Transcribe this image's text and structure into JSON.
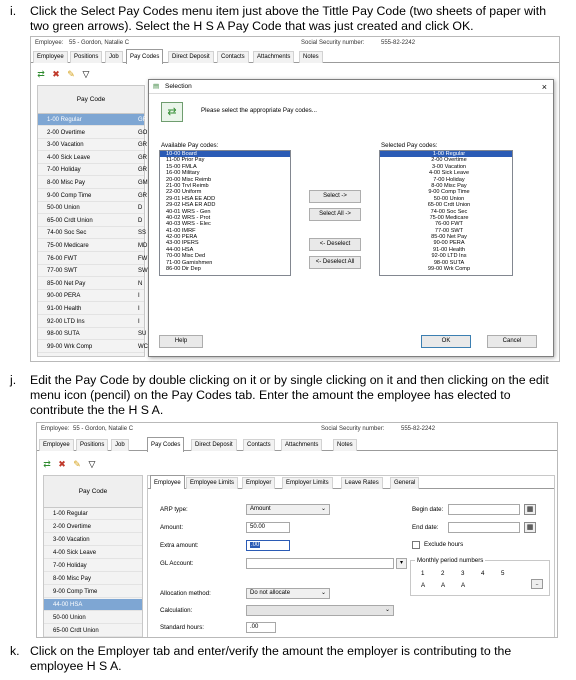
{
  "step_i": {
    "num": "i.",
    "text": "Click the Select Pay Codes menu item just above the Tittle Pay Code (two sheets of paper with two green arrows).  Select the H S A Pay Code that was just created and click OK."
  },
  "step_j": {
    "num": "j.",
    "text": "Edit the Pay Code by double clicking on it or by single clicking on it and then clicking on the edit menu icon (pencil) on the Pay Codes tab.  Enter the amount the employee has elected to contribute the the H S A."
  },
  "step_k": {
    "num": "k.",
    "text": "Click on the Employer tab and enter/verify the amount the employer is contributing to the employee H S A."
  },
  "shot1": {
    "employee_label": "Employee:",
    "employee_value": "55 - Gordon, Natalie C",
    "ssn_label": "Social Security number:",
    "ssn_value": "555-82-2242",
    "tabs": [
      "Employee",
      "Positions",
      "Job",
      "Pay Codes",
      "Direct Deposit",
      "Contacts",
      "Attachments",
      "Notes"
    ],
    "column_header": "Pay Code",
    "codes": [
      {
        "label": "1-00  Regular",
        "type": "GR"
      },
      {
        "label": "2-00  Overtime",
        "type": "GO"
      },
      {
        "label": "3-00  Vacation",
        "type": "GR"
      },
      {
        "label": "4-00  Sick Leave",
        "type": "GR"
      },
      {
        "label": "7-00  Holiday",
        "type": "GR"
      },
      {
        "label": "8-00  Misc Pay",
        "type": "GM"
      },
      {
        "label": "9-00  Comp Time",
        "type": "GR"
      },
      {
        "label": "50-00  Union",
        "type": "D"
      },
      {
        "label": "65-00  Crdt Union",
        "type": "D"
      },
      {
        "label": "74-00  Soc Sec",
        "type": "SS"
      },
      {
        "label": "75-00  Medicare",
        "type": "MD"
      },
      {
        "label": "76-00  FWT",
        "type": "FW"
      },
      {
        "label": "77-00  SWT",
        "type": "SW"
      },
      {
        "label": "85-00  Net Pay",
        "type": "N"
      },
      {
        "label": "90-00  PERA",
        "type": "I"
      },
      {
        "label": "91-00  Health",
        "type": "I"
      },
      {
        "label": "92-00  LTD Ins",
        "type": "I"
      },
      {
        "label": "98-00  SUTA",
        "type": "SU"
      },
      {
        "label": "99-00  Wrk Comp",
        "type": "WC"
      }
    ],
    "dialog": {
      "title": "Selection",
      "close": "×",
      "prompt": "Please select the appropriate Pay codes...",
      "available_label": "Available Pay codes:",
      "selected_label": "Selected Pay codes:",
      "available": [
        "10-00  Board",
        "11-00  Prior Pay",
        "15-00  FMLA",
        "16-00  Military",
        "20-00  Misc Reimb",
        "21-00  Trvl Reimb",
        "22-00  Uniform",
        "29-01  HSA EE ADD",
        "29-02  HSA ER ADD",
        "40-01  WRS - Gen",
        "40-02  WRS - Prot",
        "40-03  WRS - Elec",
        "41-00  IMRF",
        "42-00  PERA",
        "43-00  IPERS",
        "44-00  HSA",
        "70-00  Misc Ded",
        "71-00  Garnishmen",
        "86-00  Dir Dep"
      ],
      "selected": [
        "1-00  Regular",
        "2-00  Overtime",
        "3-00  Vacation",
        "4-00  Sick Leave",
        "7-00  Holiday",
        "8-00  Misc Pay",
        "9-00  Comp Time",
        "50-00  Union",
        "65-00  Crdt Union",
        "74-00  Soc Sec",
        "75-00  Medicare",
        "76-00  FWT",
        "77-00  SWT",
        "85-00  Net Pay",
        "90-00  PERA",
        "91-00  Health",
        "92-00  LTD Ins",
        "98-00  SUTA",
        "99-00  Wrk Comp"
      ],
      "select_btn": "Select ->",
      "select_all_btn": "Select All ->",
      "deselect_btn": "<- Deselect",
      "deselect_all_btn": "<- Deselect All",
      "help_btn": "Help",
      "ok_btn": "OK",
      "cancel_btn": "Cancel"
    }
  },
  "shot2": {
    "employee_label": "Employee:",
    "employee_value": "55 - Gordon, Natalie C",
    "ssn_label": "Social Security number:",
    "ssn_value": "555-82-2242",
    "tabs": [
      "Employee",
      "Positions",
      "Job",
      "Pay Codes",
      "Direct Deposit",
      "Contacts",
      "Attachments",
      "Notes"
    ],
    "column_header": "Pay Code",
    "codes": [
      "1-00  Regular",
      "2-00  Overtime",
      "3-00  Vacation",
      "4-00  Sick Leave",
      "7-00  Holiday",
      "8-00  Misc Pay",
      "9-00  Comp Time",
      "44-00  HSA",
      "50-00  Union",
      "65-00  Crdt Union"
    ],
    "detail_tabs": [
      "Employee",
      "Employee Limits",
      "Employer",
      "Employer Limits",
      "Leave Rates",
      "General"
    ],
    "arp_type_label": "ARP type:",
    "arp_type_value": "Amount",
    "amount_label": "Amount:",
    "amount_value": "50.00",
    "extra_amount_label": "Extra amount:",
    "extra_amount_value": ".00",
    "gl_account_label": "GL Account:",
    "allocation_label": "Allocation method:",
    "allocation_value": "Do not allocate",
    "calculation_label": "Calculation:",
    "standard_hours_label": "Standard hours:",
    "standard_hours_value": ".00",
    "begin_date_label": "Begin date:",
    "end_date_label": "End date:",
    "exclude_hours_label": "Exclude hours",
    "monthly_label": "Monthly period numbers",
    "period_numbers": [
      "1",
      "2",
      "3",
      "4",
      "5"
    ],
    "period_flags": [
      "A",
      "A",
      "A"
    ],
    "more_btn": ".."
  }
}
